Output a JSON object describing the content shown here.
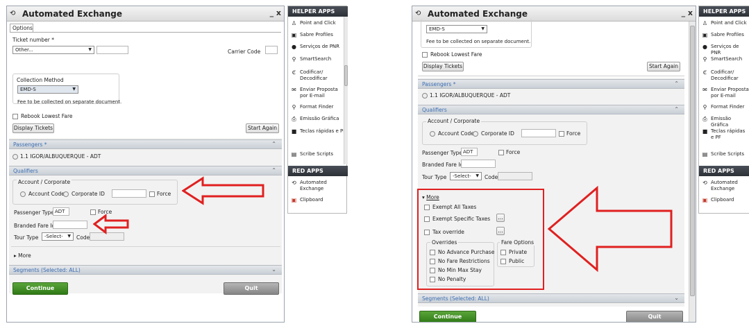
{
  "left": {
    "title": "Automated Exchange",
    "window_controls": "_ x",
    "tab_options": "Options",
    "ticket_number_label": "Ticket number *",
    "ticket_select_value": "Other...",
    "carrier_code_label": "Carrier Code",
    "collection_method_label": "Collection Method",
    "collection_select_value": "EMD-S",
    "collection_note": "Fee to be collected on separate document.",
    "rebook_label": "Rebook Lowest Fare",
    "display_tickets": "Display Tickets",
    "start_again": "Start Again",
    "passengers_header": "Passengers *",
    "passenger_name": "1.1 IGOR/ALBUQUERQUE - ADT",
    "qualifiers_header": "Qualifiers",
    "account_corporate_label": "Account / Corporate",
    "account_code_label": "Account Code",
    "corporate_id_label": "Corporate ID",
    "force_label": "Force",
    "passenger_type_label": "Passenger Type",
    "passenger_type_value": "ADT",
    "force2_label": "Force",
    "branded_fare_label": "Branded Fare Id",
    "tour_type_label": "Tour Type",
    "tour_type_value": "-Select-",
    "code_label": "Code",
    "more_label": "More",
    "segments_header": "Segments (Selected: ALL)",
    "continue": "Continue",
    "quit": "Quit"
  },
  "left_helper": {
    "header": "HELPER APPS",
    "items": [
      "Point and Click",
      "Sabre Profiles",
      "Serviços de PNR",
      "SmartSearch",
      "Codificar/ Decodificar",
      "Enviar Proposta por E-mail",
      "Format Finder",
      "Emissão Gráfica",
      "Teclas rápidas e PF",
      "Scribe Scripts"
    ],
    "red_header": "RED APPS",
    "red_items": [
      "Automated Exchange",
      "Clipboard"
    ]
  },
  "right": {
    "title": "Automated Exchange",
    "window_controls": "_ x",
    "collection_select_value": "EMD-S",
    "collection_note": "Fee to be collected on separate document.",
    "rebook_label": "Rebook Lowest Fare",
    "display_tickets": "Display Tickets",
    "start_again": "Start Again",
    "passengers_header": "Passengers *",
    "passenger_name": "1.1 IGOR/ALBUQUERQUE - ADT",
    "qualifiers_header": "Qualifiers",
    "account_corporate_label": "Account / Corporate",
    "account_code_label": "Account Code",
    "corporate_id_label": "Corporate ID",
    "force_label": "Force",
    "passenger_type_label": "Passenger Type",
    "passenger_type_value": "ADT",
    "force2_label": "Force",
    "branded_fare_label": "Branded Fare Id",
    "tour_type_label": "Tour Type",
    "tour_type_value": "-Select-",
    "code_label": "Code",
    "more_label": "More",
    "exempt_all_taxes": "Exempt All Taxes",
    "exempt_specific_taxes": "Exempt Specific Taxes",
    "tax_override": "Tax override",
    "ellipsis": "...",
    "overrides_label": "Overrides",
    "overrides": [
      "No Advance Purchase",
      "No Fare Restrictions",
      "No Min Max Stay",
      "No Penalty"
    ],
    "fare_options_label": "Fare Options",
    "fare_options": [
      "Private",
      "Public"
    ],
    "segments_header": "Segments (Selected: ALL)",
    "continue": "Continue",
    "quit": "Quit"
  },
  "right_helper": {
    "header": "HELPER APPS",
    "items": [
      "Point and Click",
      "Sabre Profiles",
      "Serviços de PNR",
      "SmartSearch",
      "Codificar/ Decodificar",
      "Enviar Proposta por E-mail",
      "Format Finder",
      "Emissão Gráfica",
      "Teclas rápidas e PF",
      "Scribe Scripts"
    ],
    "red_header": "RED APPS",
    "red_items": [
      "Automated Exchange",
      "Clipboard"
    ]
  },
  "colors": {
    "accent_blue": "#3d6fb2",
    "annotation_red": "#e02020",
    "continue_green": "#3f8a20"
  }
}
